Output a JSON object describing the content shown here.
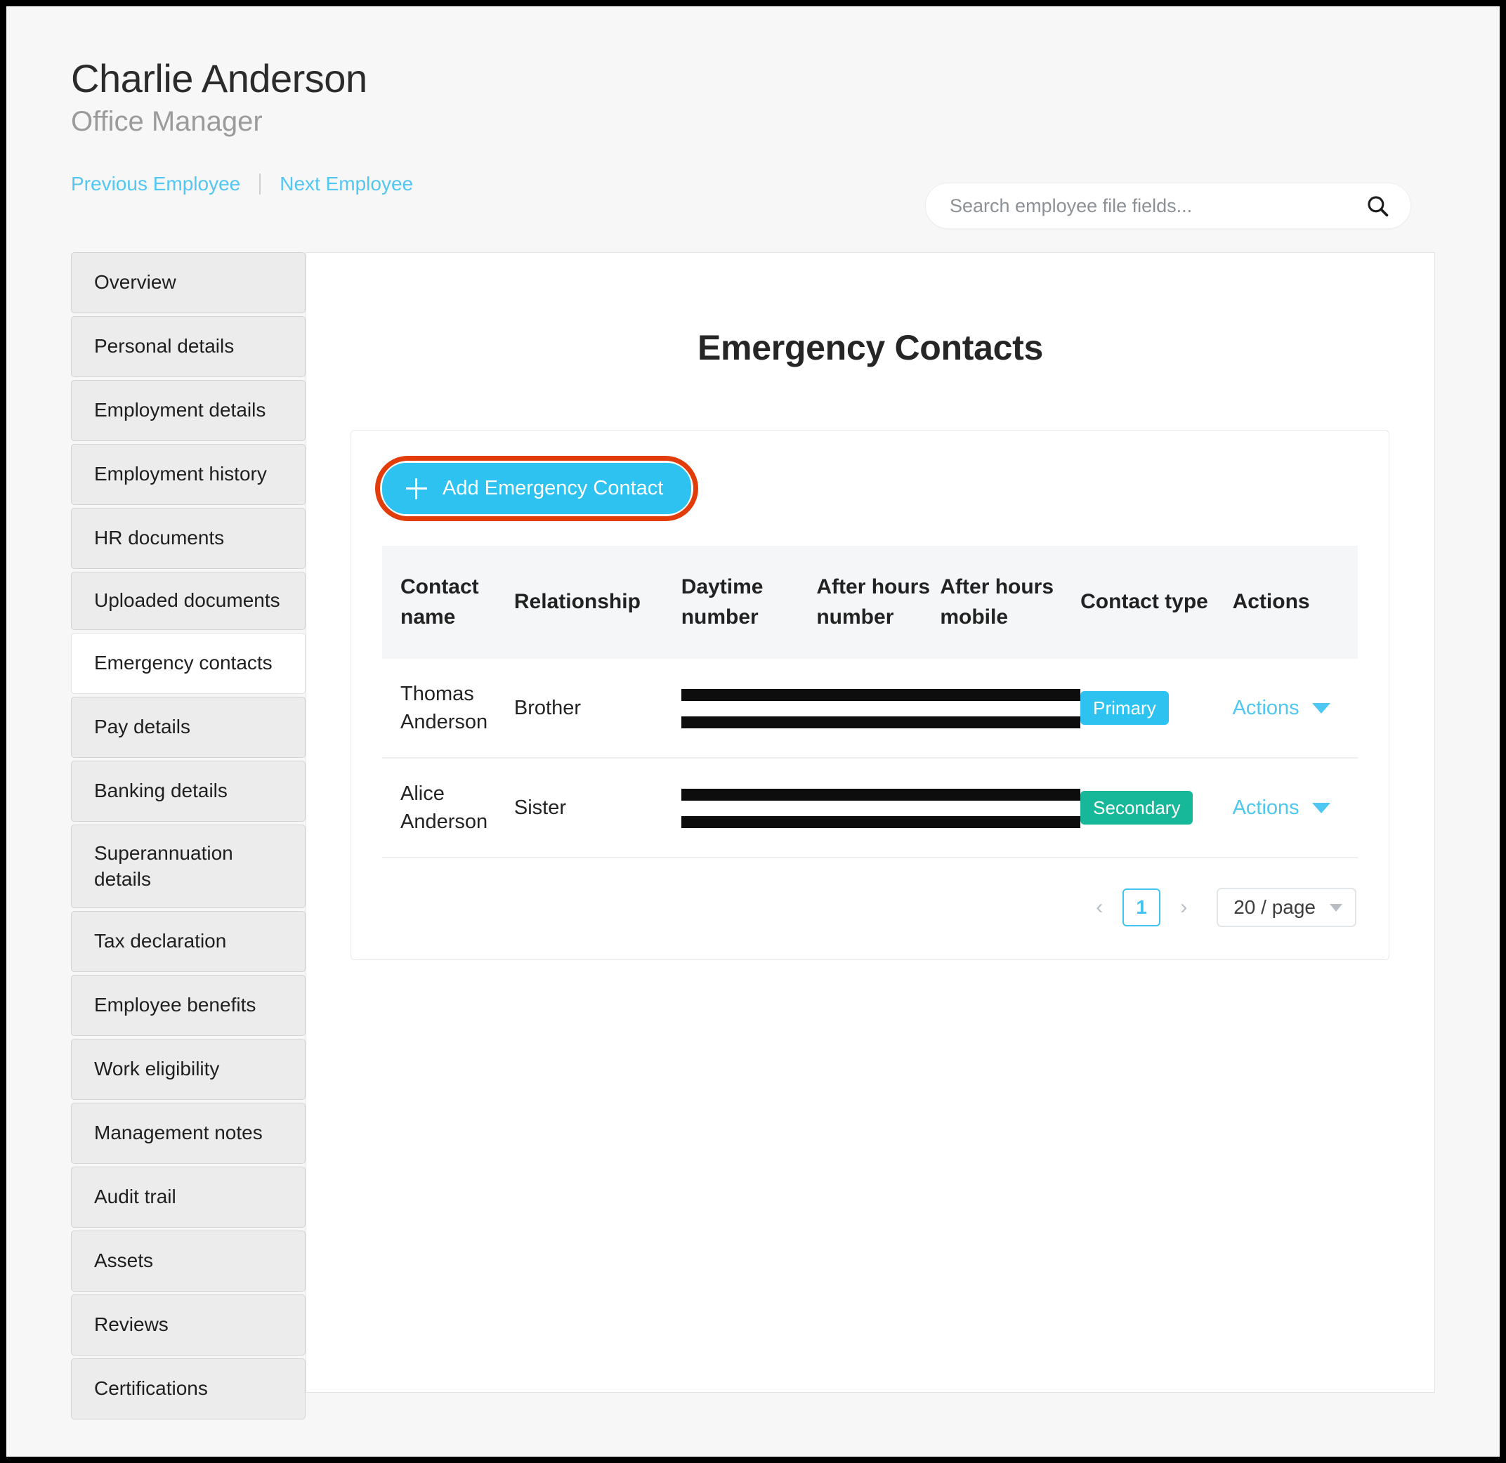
{
  "header": {
    "employee_name": "Charlie Anderson",
    "employee_role": "Office Manager",
    "previous_employee": "Previous Employee",
    "next_employee": "Next Employee"
  },
  "search": {
    "placeholder": "Search employee file fields...",
    "value": ""
  },
  "sidebar": {
    "items": [
      {
        "label": "Overview",
        "active": false
      },
      {
        "label": "Personal details",
        "active": false
      },
      {
        "label": "Employment details",
        "active": false
      },
      {
        "label": "Employment history",
        "active": false
      },
      {
        "label": "HR documents",
        "active": false
      },
      {
        "label": "Uploaded documents",
        "active": false
      },
      {
        "label": "Emergency contacts",
        "active": true
      },
      {
        "label": "Pay details",
        "active": false
      },
      {
        "label": "Banking details",
        "active": false
      },
      {
        "label": "Superannuation details",
        "active": false
      },
      {
        "label": "Tax declaration",
        "active": false
      },
      {
        "label": "Employee benefits",
        "active": false
      },
      {
        "label": "Work eligibility",
        "active": false
      },
      {
        "label": "Management notes",
        "active": false
      },
      {
        "label": "Audit trail",
        "active": false
      },
      {
        "label": "Assets",
        "active": false
      },
      {
        "label": "Reviews",
        "active": false
      },
      {
        "label": "Certifications",
        "active": false
      }
    ]
  },
  "main": {
    "title": "Emergency Contacts",
    "add_button_label": "Add Emergency Contact",
    "highlight_color": "#e23c0b",
    "accent_color": "#2ec2f0"
  },
  "table": {
    "columns": [
      "Contact name",
      "Relationship",
      "Daytime number",
      "After hours number",
      "After hours mobile",
      "Contact type",
      "Actions"
    ],
    "rows": [
      {
        "contact_name": "Thomas Anderson",
        "relationship": "Brother",
        "daytime_number": "",
        "after_hours_number": "",
        "after_hours_mobile": "",
        "contact_type": "Primary",
        "contact_type_color": "#2ec2f0",
        "actions_label": "Actions",
        "redacted": true
      },
      {
        "contact_name": "Alice Anderson",
        "relationship": "Sister",
        "daytime_number": "",
        "after_hours_number": "",
        "after_hours_mobile": "",
        "contact_type": "Secondary",
        "contact_type_color": "#17b89a",
        "actions_label": "Actions",
        "redacted": true
      }
    ]
  },
  "pagination": {
    "prev_label": "‹",
    "next_label": "›",
    "current_page": "1",
    "page_size": "20 / page"
  }
}
